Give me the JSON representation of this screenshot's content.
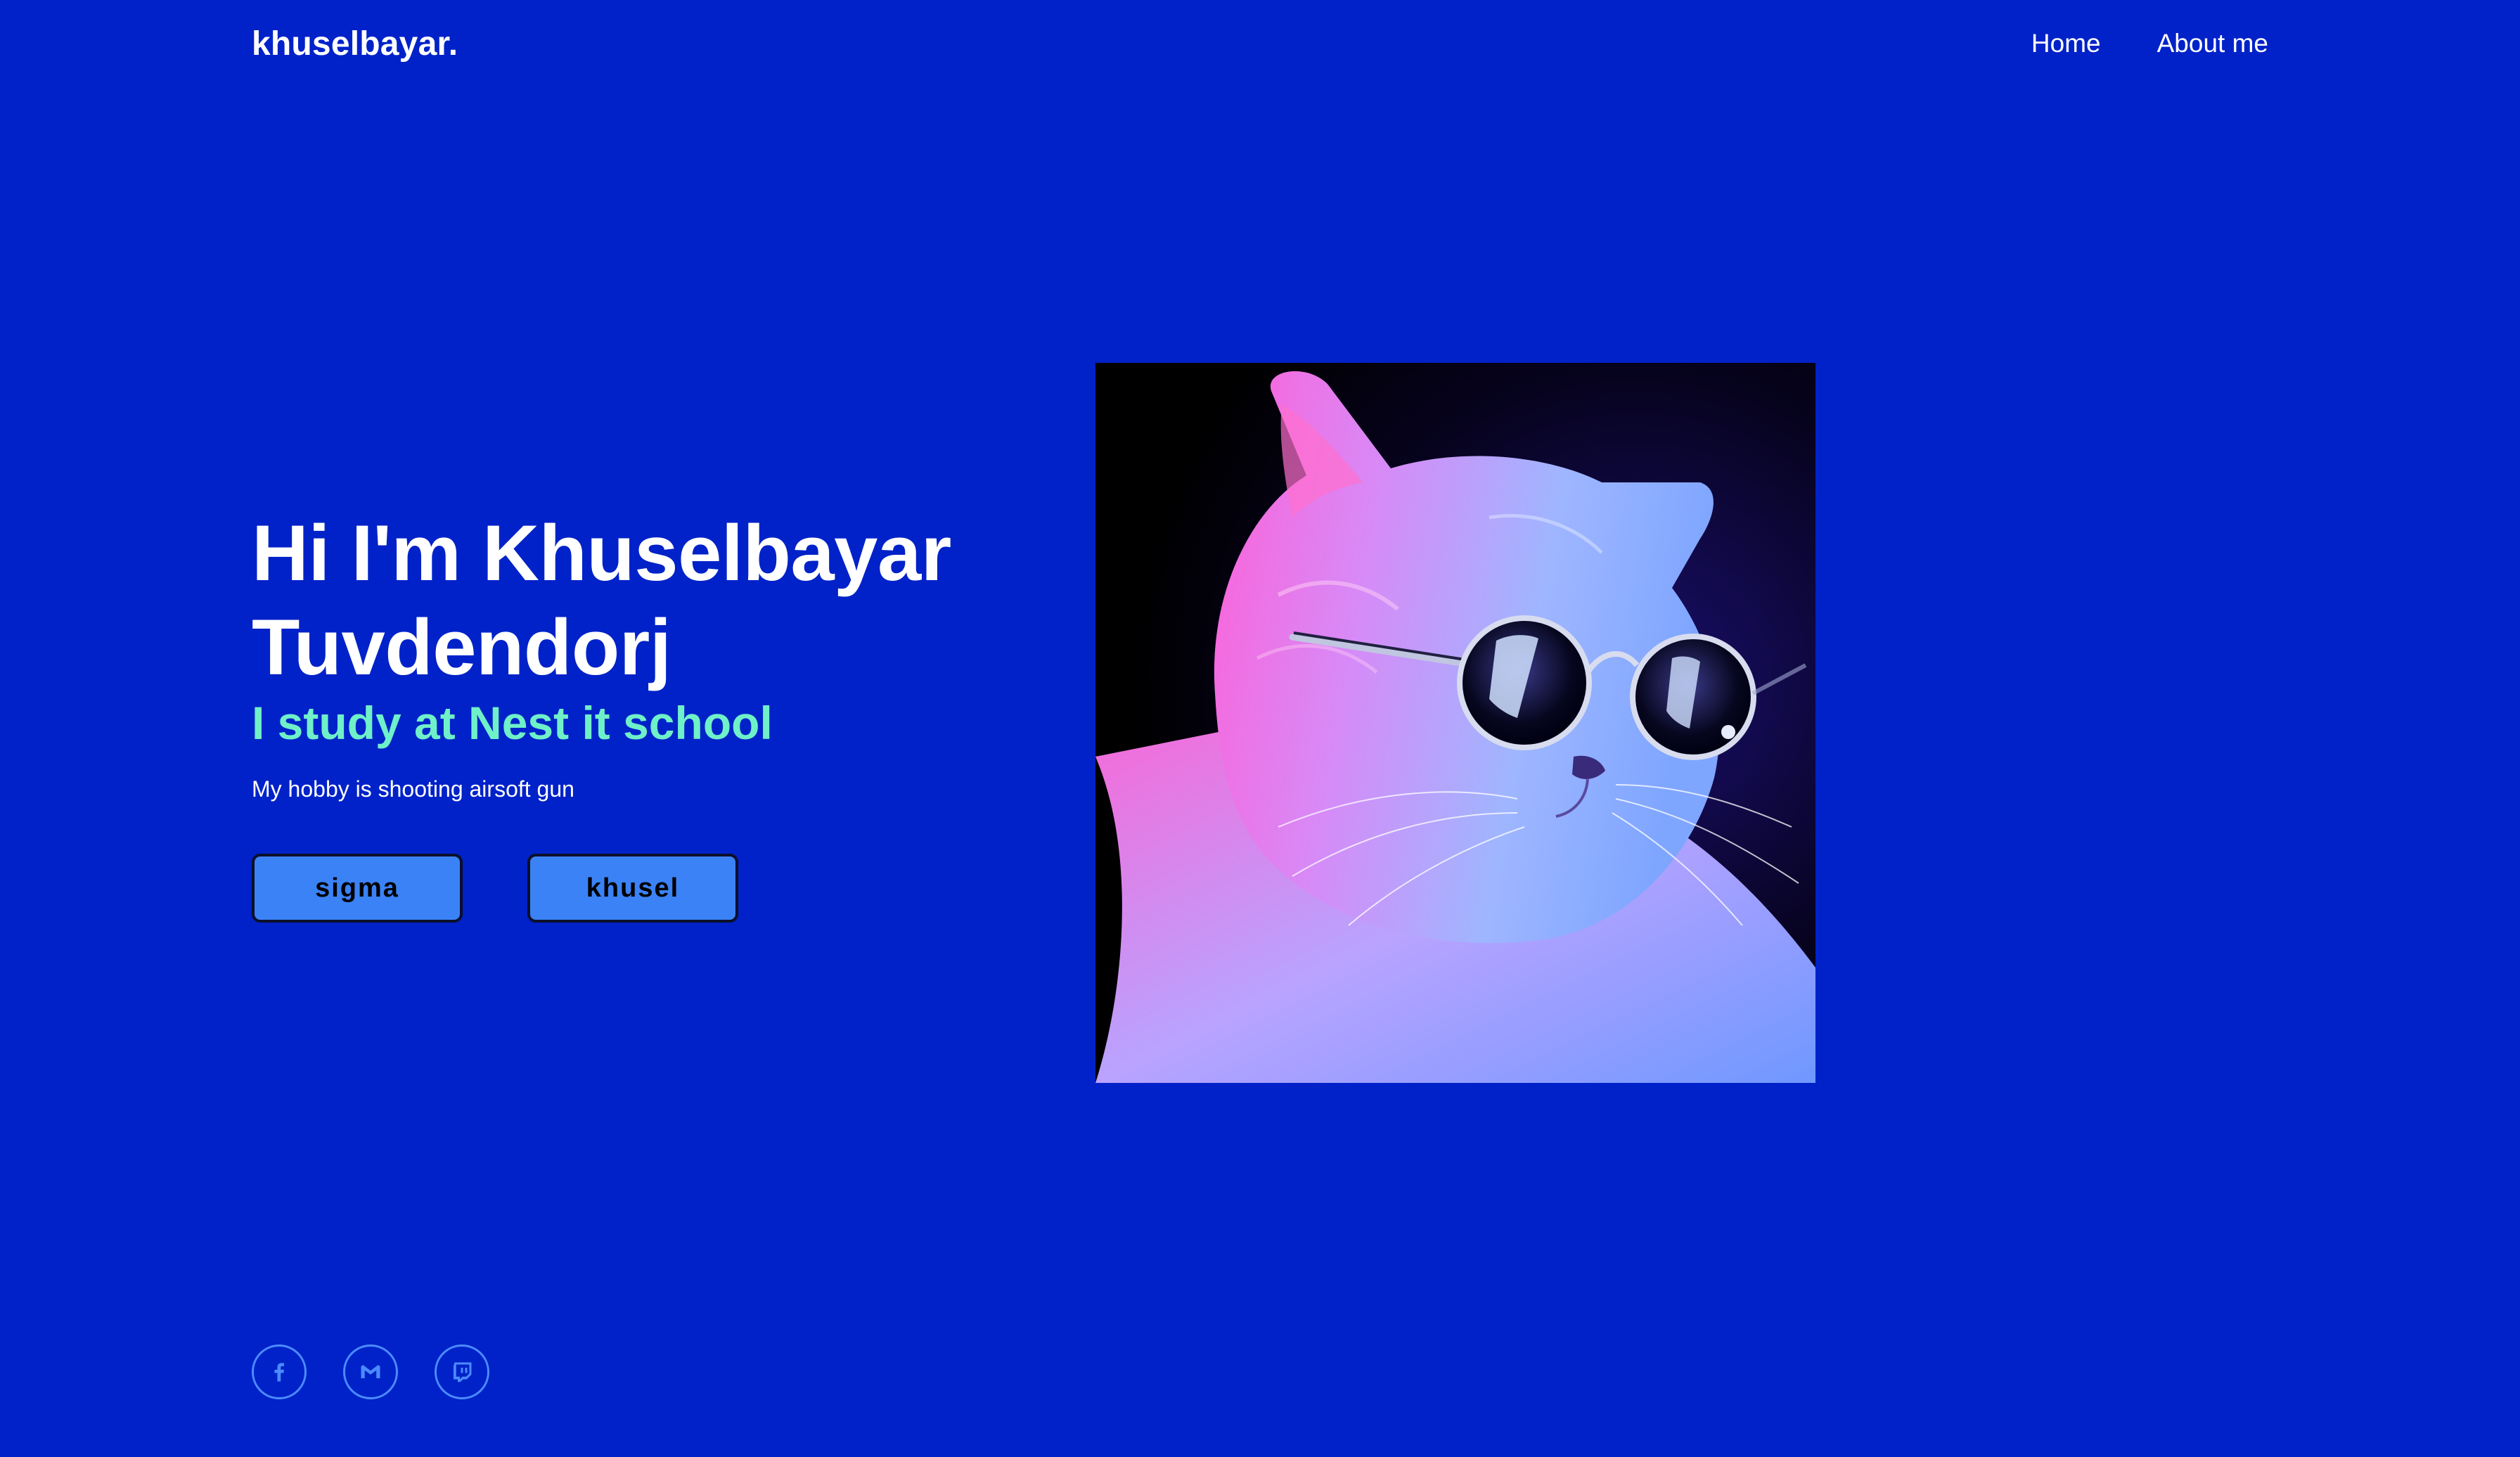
{
  "header": {
    "logo": "khuselbayar.",
    "nav": [
      {
        "label": "Home"
      },
      {
        "label": "About me"
      }
    ]
  },
  "hero": {
    "title_line1": "Hi I'm Khuselbayar",
    "title_line2": "Tuvdendorj",
    "subtitle": "I study at Nest it school",
    "description": "My hobby is shooting airsoft gun",
    "buttons": [
      {
        "label": "sigma"
      },
      {
        "label": "khusel"
      }
    ],
    "image_description": "cat-with-sunglasses"
  },
  "socials": [
    {
      "icon": "facebook-icon"
    },
    {
      "icon": "gmail-icon"
    },
    {
      "icon": "twitch-icon"
    }
  ],
  "colors": {
    "background": "#0022c8",
    "accent_text": "#6ff0c8",
    "button_bg": "#3b82f6",
    "social_ring": "#4c8bff"
  }
}
